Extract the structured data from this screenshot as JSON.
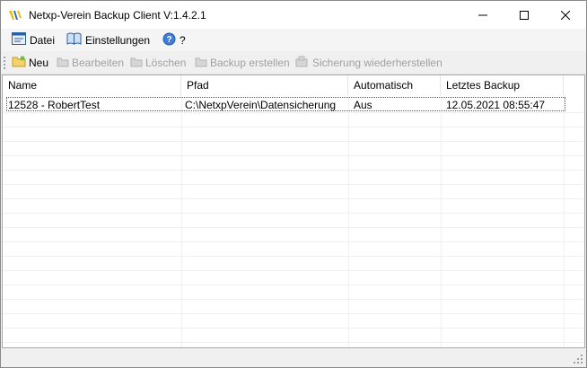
{
  "window": {
    "title": "Netxp-Verein Backup Client V:1.4.2.1",
    "minimize_icon": "minimize-icon",
    "maximize_icon": "maximize-icon",
    "close_icon": "close-icon"
  },
  "menu": {
    "items": [
      {
        "label": "Datei",
        "icon": "file-menu-icon"
      },
      {
        "label": "Einstellungen",
        "icon": "book-icon"
      },
      {
        "label": "?",
        "icon": "help-icon"
      }
    ]
  },
  "toolbar": {
    "items": [
      {
        "label": "Neu",
        "icon": "new-folder-icon",
        "enabled": true
      },
      {
        "label": "Bearbeiten",
        "icon": "edit-icon",
        "enabled": false
      },
      {
        "label": "Löschen",
        "icon": "delete-icon",
        "enabled": false
      },
      {
        "label": "Backup erstellen",
        "icon": "backup-icon",
        "enabled": false
      },
      {
        "label": "Sicherung wiederherstellen",
        "icon": "restore-icon",
        "enabled": false
      }
    ]
  },
  "table": {
    "columns": [
      "Name",
      "Pfad",
      "Automatisch",
      "Letztes Backup"
    ],
    "rows": [
      [
        "12528 - RobertTest",
        "C:\\NetxpVerein\\Datensicherung",
        "Aus",
        "12.05.2021 08:55:47"
      ]
    ]
  },
  "colors": {
    "accent": "#0078d7",
    "disabled_text": "#a0a0a0",
    "toolbar_bg": "#f0f0f0"
  }
}
